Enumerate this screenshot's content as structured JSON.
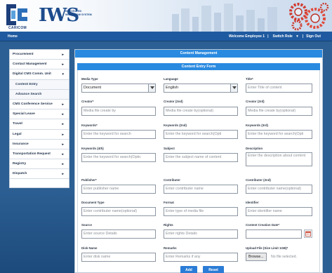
{
  "header": {
    "caricom_label": "CARICOM",
    "iws_mark": "IWS",
    "iws_subtitle": "INTEGRATED WORKFLOW SYSTEM"
  },
  "navbar": {
    "home": "Home",
    "welcome": "Welcome Employee 1",
    "sep1": "|",
    "switch_role": "Switch Role",
    "switch_role_caret": "▾",
    "sep2": "|",
    "sign_out": "Sign Out"
  },
  "sidebar": {
    "items": [
      {
        "label": "Procurement",
        "arrow": "►"
      },
      {
        "label": "Contact Management",
        "arrow": "►"
      },
      {
        "label": "Digital CMS Comm. Unit",
        "arrow": "▼"
      },
      {
        "label": "Content Entry",
        "arrow": ""
      },
      {
        "label": "Advance Search",
        "arrow": ""
      },
      {
        "label": "CMS Conference Service",
        "arrow": "►"
      },
      {
        "label": "Special Leave",
        "arrow": "►"
      },
      {
        "label": "Travel",
        "arrow": "►"
      },
      {
        "label": "Legal",
        "arrow": "►"
      },
      {
        "label": "Insurance",
        "arrow": "►"
      },
      {
        "label": "Transportation Request",
        "arrow": "►"
      },
      {
        "label": "Registry",
        "arrow": "►"
      },
      {
        "label": "Dispatch",
        "arrow": "►"
      }
    ]
  },
  "main": {
    "title": "Content Management",
    "form_title": "Content Entry Form"
  },
  "form": {
    "media_type": {
      "label": "Media Type",
      "value": "Document"
    },
    "language": {
      "label": "Language",
      "value": "English"
    },
    "title": {
      "label": "Title*",
      "placeholder": "Enter Title of content"
    },
    "creator": {
      "label": "Creator*",
      "placeholder": "Media file create by"
    },
    "creator2": {
      "label": "Creator (2nd)",
      "placeholder": "Media file create by(optional)"
    },
    "creator3": {
      "label": "Creator (3rd)",
      "placeholder": "Media file create by(optional)"
    },
    "keywords": {
      "label": "Keywords*",
      "placeholder": "Enter the keyword for search"
    },
    "keywords2": {
      "label": "Keywords (2nd)",
      "placeholder": "Enter the keyword for search(Opti"
    },
    "keywords3": {
      "label": "Keywords (3rd)",
      "placeholder": "Enter the keyword for search(Opti"
    },
    "keywords4": {
      "label": "Keywords (4th)",
      "placeholder": "Enter the keyword for search(Optic"
    },
    "subject": {
      "label": "Subject",
      "placeholder": "Enter the subject name of content"
    },
    "description": {
      "label": "Description",
      "placeholder": "Enter the description about content"
    },
    "publisher": {
      "label": "Publisher*",
      "placeholder": "Enter publisher name"
    },
    "contributer": {
      "label": "Contributer",
      "placeholder": "Enter contributer name"
    },
    "contributer2": {
      "label": "Contributer (2nd)",
      "placeholder": "Enter contributer name(optional)"
    },
    "document_type": {
      "label": "Document Type",
      "placeholder": "Enter contributer name(optional)"
    },
    "format": {
      "label": "Format",
      "placeholder": "Enter type of media file"
    },
    "identifier": {
      "label": "Identifier",
      "placeholder": "Enter identifier name"
    },
    "source": {
      "label": "Source",
      "placeholder": "Enter source Details"
    },
    "rights": {
      "label": "Rights",
      "placeholder": "Enter rights Details"
    },
    "creation_date": {
      "label": "Content Creation Date*",
      "placeholder": ""
    },
    "disk_name": {
      "label": "Disk Name",
      "placeholder": "Enter disk name"
    },
    "remarks": {
      "label": "Remarks",
      "placeholder": "Enter Remarks if any"
    },
    "upload": {
      "label": "Upload File (Size Limit 1GB)*",
      "button": "Browse...",
      "status": "No file selected."
    },
    "add_button": "Add",
    "reset_button": "Reset"
  },
  "colors": {
    "navbar": "#1f5aa0",
    "panel_header": "#2a8ae0",
    "button": "#2a7cd6",
    "page_bg": "#2c5f93"
  }
}
